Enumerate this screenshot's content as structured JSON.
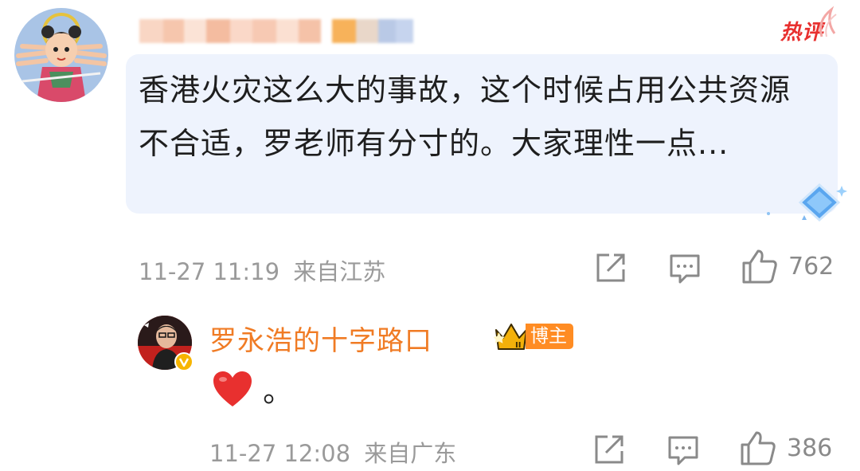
{
  "comment": {
    "hot_label": "热评",
    "text": "香港火灾这么大的事故，这个时候占用公共资源不合适，罗老师有分寸的。大家理性一点...",
    "time": "11-27 11:19",
    "location": "来自江苏",
    "like_count": "762",
    "icons": [
      "share-icon",
      "comment-icon",
      "like-icon"
    ]
  },
  "reply": {
    "username": "罗永浩的十字路口",
    "badge_label": "博主",
    "text_suffix": "。",
    "time": "11-27 12:08",
    "location": "来自广东",
    "like_count": "386",
    "icons": [
      "heart-emoji-icon",
      "crown-icon",
      "verified-icon",
      "share-icon",
      "comment-icon",
      "like-icon"
    ]
  },
  "colors": {
    "accent_orange": "#f07b24",
    "hot_red": "#e8302f",
    "bubble_bg": "#eef3fd",
    "meta_gray": "#9a9a9a"
  }
}
